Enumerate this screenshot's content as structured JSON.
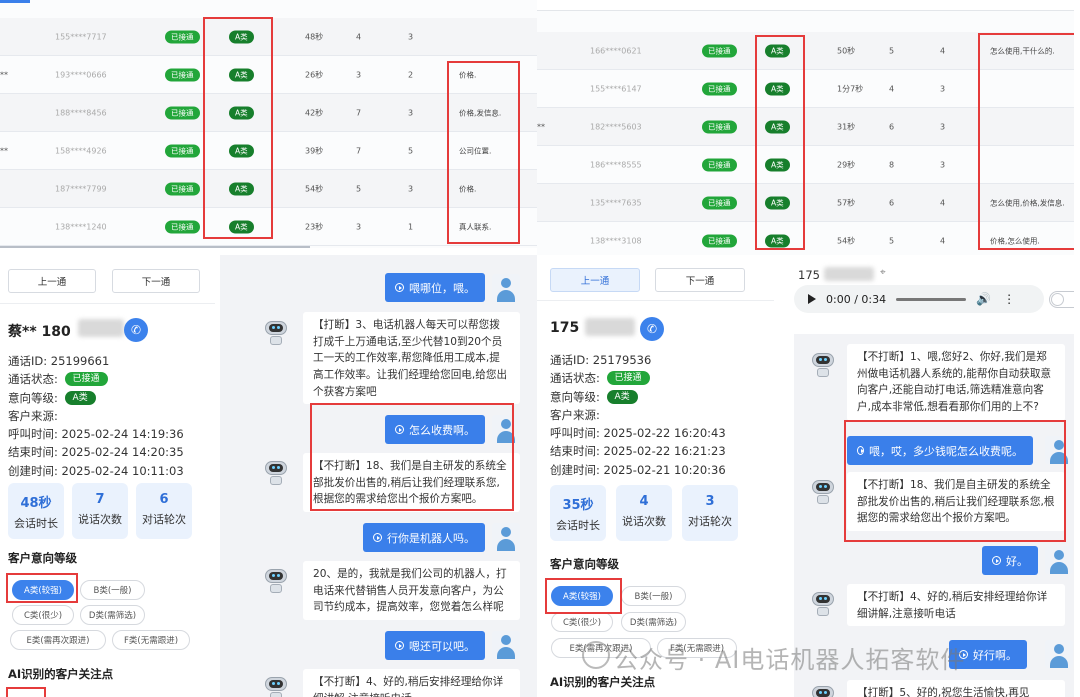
{
  "left": {
    "rows": [
      {
        "pre": "",
        "phone": "155****7717",
        "status": "已接通",
        "level": "A类",
        "dur": "48秒",
        "n1": "4",
        "n2": "3",
        "note": ""
      },
      {
        "pre": "**",
        "phone": "193****0666",
        "status": "已接通",
        "level": "A类",
        "dur": "26秒",
        "n1": "3",
        "n2": "2",
        "note": "价格."
      },
      {
        "pre": "",
        "phone": "188****8456",
        "status": "已接通",
        "level": "A类",
        "dur": "42秒",
        "n1": "7",
        "n2": "3",
        "note": "价格,发信息."
      },
      {
        "pre": "**",
        "phone": "158****4926",
        "status": "已接通",
        "level": "A类",
        "dur": "39秒",
        "n1": "7",
        "n2": "5",
        "note": "公司位置."
      },
      {
        "pre": "",
        "phone": "187****7799",
        "status": "已接通",
        "level": "A类",
        "dur": "54秒",
        "n1": "5",
        "n2": "3",
        "note": "价格."
      },
      {
        "pre": "",
        "phone": "138****1240",
        "status": "已接通",
        "level": "A类",
        "dur": "23秒",
        "n1": "3",
        "n2": "1",
        "note": "真人联系."
      }
    ],
    "prev": "上一通",
    "next": "下一通",
    "name": "蔡** 180",
    "info": {
      "id_label": "通话ID:",
      "id": "25199661",
      "status_label": "通话状态:",
      "status": "已接通",
      "level_label": "意向等级:",
      "level": "A类",
      "source_label": "客户来源:",
      "call_label": "呼叫时间:",
      "call": "2025-02-24 14:19:36",
      "end_label": "结束时间:",
      "end": "2025-02-24 14:20:35",
      "create_label": "创建时间:",
      "create": "2025-02-24 10:11:03"
    },
    "stats": [
      {
        "v": "48秒",
        "l": "会话时长"
      },
      {
        "v": "7",
        "l": "说话次数"
      },
      {
        "v": "6",
        "l": "对话轮次"
      }
    ],
    "section": "客户意向等级",
    "levels": [
      "A类(较强)",
      "B类(一般)",
      "C类(很少)",
      "D类(需筛选)",
      "E类(需再次跟进)",
      "F类(无需跟进)"
    ],
    "focus": "AI识别的客户关注点",
    "chat": [
      {
        "t": "user",
        "text": "喂哪位，喂。"
      },
      {
        "t": "bot",
        "text": "【打断】3、电话机器人每天可以帮您拨打成千上万通电话,至少代替10到20个员工一天的工作效率,帮您降低用工成本,提高工作效率。让我们经理给您回电,给您出个获客方案吧"
      },
      {
        "t": "user",
        "text": "怎么收费啊。"
      },
      {
        "t": "bot",
        "text": "【不打断】18、我们是自主研发的系统全部批发价出售的,稍后让我们经理联系您,根据您的需求给您出个报价方案吧。"
      },
      {
        "t": "user",
        "text": "行你是机器人吗。"
      },
      {
        "t": "bot",
        "text": "20、是的，我就是我们公司的机器人，打电话来代替销售人员开发意向客户，为公司节约成本，提高效率，您觉着怎么样呢"
      },
      {
        "t": "user",
        "text": "嗯还可以吧。"
      },
      {
        "t": "bot",
        "text": "【不打断】4、好的,稍后安排经理给你详细讲解,注意接听电话"
      }
    ]
  },
  "right": {
    "rows": [
      {
        "pre": "",
        "phone": "166****0621",
        "status": "已接通",
        "level": "A类",
        "dur": "50秒",
        "n1": "5",
        "n2": "4",
        "note": "怎么使用,干什么的."
      },
      {
        "pre": "",
        "phone": "155****6147",
        "status": "已接通",
        "level": "A类",
        "dur": "1分7秒",
        "n1": "4",
        "n2": "3",
        "note": ""
      },
      {
        "pre": "**",
        "phone": "182****5603",
        "status": "已接通",
        "level": "A类",
        "dur": "31秒",
        "n1": "6",
        "n2": "3",
        "note": ""
      },
      {
        "pre": "",
        "phone": "186****8555",
        "status": "已接通",
        "level": "A类",
        "dur": "29秒",
        "n1": "8",
        "n2": "3",
        "note": ""
      },
      {
        "pre": "",
        "phone": "135****7635",
        "status": "已接通",
        "level": "A类",
        "dur": "57秒",
        "n1": "6",
        "n2": "4",
        "note": "怎么使用,价格,发信息."
      },
      {
        "pre": "",
        "phone": "138****3108",
        "status": "已接通",
        "level": "A类",
        "dur": "54秒",
        "n1": "5",
        "n2": "4",
        "note": "价格,怎么使用."
      }
    ],
    "prev": "上一通",
    "next": "下一通",
    "name": "175",
    "audio_name": "175",
    "audio_time": "0:00 / 0:34",
    "info": {
      "id_label": "通话ID:",
      "id": "25179536",
      "status_label": "通话状态:",
      "status": "已接通",
      "level_label": "意向等级:",
      "level": "A类",
      "source_label": "客户来源:",
      "call_label": "呼叫时间:",
      "call": "2025-02-22 16:20:43",
      "end_label": "结束时间:",
      "end": "2025-02-22 16:21:23",
      "create_label": "创建时间:",
      "create": "2025-02-21 10:20:36"
    },
    "stats": [
      {
        "v": "35秒",
        "l": "会话时长"
      },
      {
        "v": "4",
        "l": "说话次数"
      },
      {
        "v": "3",
        "l": "对话轮次"
      }
    ],
    "section": "客户意向等级",
    "levels": [
      "A类(较强)",
      "B类(一般)",
      "C类(很少)",
      "D类(需筛选)",
      "E类(需再次跟进)",
      "F类(无需跟进)"
    ],
    "focus": "AI识别的客户关注点",
    "chat": [
      {
        "t": "bot",
        "text": "【不打断】1、喂,您好2、你好,我们是郑州做电话机器人系统的,能帮你自动获取意向客户,还能自动打电话,筛选精准意向客户,成本非常低,想看看那你们用的上不?"
      },
      {
        "t": "user",
        "text": "喂，哎，多少钱呢怎么收费呢。"
      },
      {
        "t": "bot",
        "text": "【不打断】18、我们是自主研发的系统全部批发价出售的,稍后让我们经理联系您,根据您的需求给您出个报价方案吧。"
      },
      {
        "t": "user",
        "text": "好。"
      },
      {
        "t": "bot",
        "text": "【不打断】4、好的,稍后安排经理给你详细讲解,注意接听电话"
      },
      {
        "t": "user",
        "text": "好行啊。"
      },
      {
        "t": "bot",
        "text": "【打断】5、好的,祝您生活愉快,再见"
      }
    ]
  },
  "watermark": "公众号 · AI电话机器人拓客软件"
}
